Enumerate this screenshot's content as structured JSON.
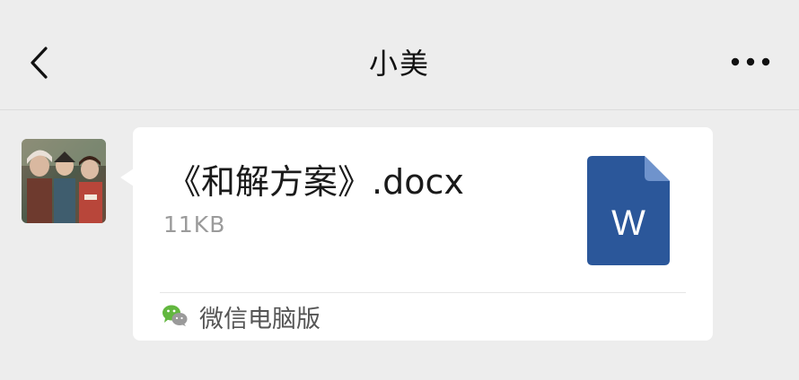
{
  "header": {
    "title": "小美"
  },
  "message": {
    "file_name": "《和解方案》.docx",
    "file_size": "11KB",
    "file_icon_letter": "W",
    "source": "微信电脑版"
  },
  "colors": {
    "background": "#ededed",
    "bubble": "#ffffff",
    "word_blue": "#2b579a",
    "wechat_green": "#62b73f"
  },
  "icons": {
    "back": "chevron-left-icon",
    "more": "more-horizontal-icon",
    "file": "word-document-icon",
    "source": "wechat-icon"
  }
}
